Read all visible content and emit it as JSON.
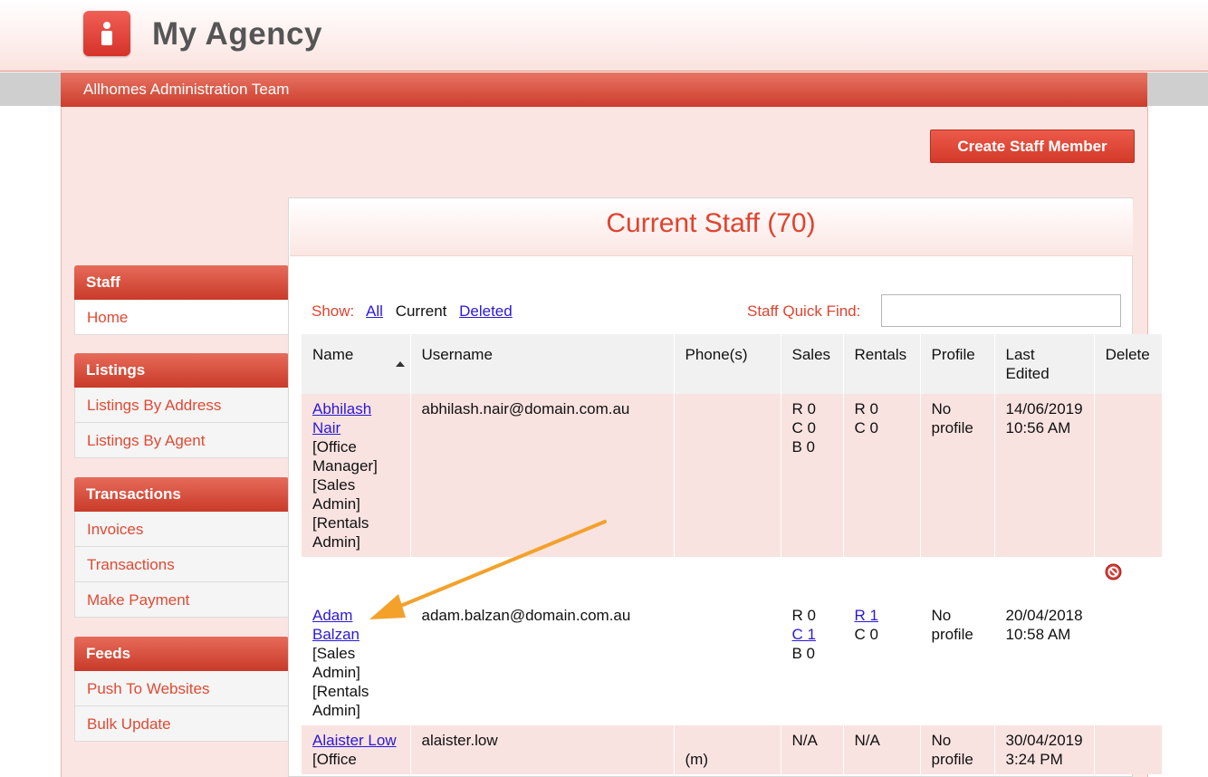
{
  "header": {
    "app_title": "My Agency",
    "team_name": "Allhomes Administration Team",
    "logo_icon": "agency-logo-icon"
  },
  "actions": {
    "create_staff_label": "Create Staff Member"
  },
  "sidebar": {
    "groups": [
      {
        "heading": "Staff",
        "items": [
          "Home"
        ]
      },
      {
        "heading": "Listings",
        "items": [
          "Listings By Address",
          "Listings By Agent"
        ]
      },
      {
        "heading": "Transactions",
        "items": [
          "Invoices",
          "Transactions",
          "Make Payment"
        ]
      },
      {
        "heading": "Feeds",
        "items": [
          "Push To Websites",
          "Bulk Update"
        ]
      }
    ]
  },
  "main": {
    "title": "Current Staff (70)",
    "show_label": "Show:",
    "filters": {
      "all": "All",
      "current": "Current",
      "deleted": "Deleted"
    },
    "quick_find_label": "Staff Quick Find:",
    "quick_find_value": ""
  },
  "table": {
    "headers": {
      "name": "Name",
      "username": "Username",
      "phones": "Phone(s)",
      "sales": "Sales",
      "rentals": "Rentals",
      "profile": "Profile",
      "last_edited_1": "Last",
      "last_edited_2": "Edited",
      "delete": "Delete"
    },
    "rows": [
      {
        "name_1": "Abhilash",
        "name_2": "Nair",
        "roles": [
          "[Office",
          "Manager]",
          "[Sales",
          "Admin]",
          "[Rentals",
          "Admin]"
        ],
        "username": "abhilash.nair@domain.com.au",
        "phone": "",
        "sales": [
          "R 0",
          "C 0",
          "B 0"
        ],
        "rentals": [
          "R 0",
          "C 0"
        ],
        "profile_1": "No",
        "profile_2": "profile",
        "edited_date": "14/06/2019",
        "edited_time": "10:56 AM"
      },
      {
        "name_1": "Adam",
        "name_2": "Balzan",
        "roles": [
          "[Sales",
          "Admin]",
          "[Rentals",
          "Admin]"
        ],
        "username": "adam.balzan@domain.com.au",
        "phone": "",
        "sales": [
          "R 0",
          "C 1 ",
          "B 0"
        ],
        "rentals": [
          "R 1 ",
          "C 0"
        ],
        "profile_1": "No",
        "profile_2": "profile",
        "edited_date": "20/04/2018",
        "edited_time": "10:58 AM"
      },
      {
        "name_1": "Alaister Low",
        "roles": [
          "[Office"
        ],
        "username": "alaister.low",
        "phone": "(m)",
        "sales": [
          "N/A"
        ],
        "rentals": [
          "N/A"
        ],
        "profile_1": "No",
        "profile_2": "profile",
        "edited_date": "30/04/2019",
        "edited_time": "3:24 PM"
      }
    ]
  },
  "colors": {
    "accent": "#e0432f",
    "header_red": "#cc3d2c",
    "panel_pink": "#fbe5e2",
    "link_blue": "#2a19d6",
    "annotation_arrow": "#f3a12b"
  }
}
